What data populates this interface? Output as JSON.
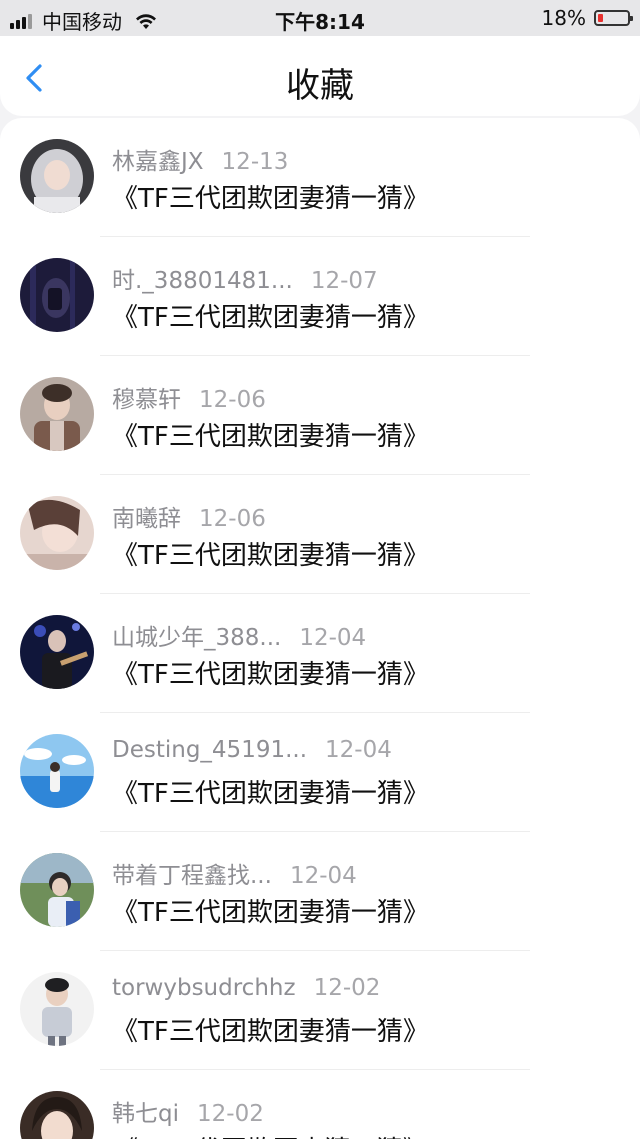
{
  "status_bar": {
    "carrier": "中国移动",
    "time": "下午8:14",
    "battery_percent": "18%",
    "battery_level": 0.18,
    "battery_color": "#e8312f",
    "icons": [
      "signal-icon",
      "wifi-icon",
      "battery-icon"
    ]
  },
  "nav": {
    "title": "收藏",
    "back_icon": "chevron-left-icon",
    "accent": "#2f8ef3"
  },
  "favorites": [
    {
      "user": "林嘉鑫JX",
      "date": "12-13",
      "title": "《TF三代团欺团妻猜一猜》"
    },
    {
      "user": "时._38801481...",
      "date": "12-07",
      "title": "《TF三代团欺团妻猜一猜》"
    },
    {
      "user": "穆慕轩",
      "date": "12-06",
      "title": "《TF三代团欺团妻猜一猜》"
    },
    {
      "user": "南曦辞",
      "date": "12-06",
      "title": "《TF三代团欺团妻猜一猜》"
    },
    {
      "user": "山城少年_388...",
      "date": "12-04",
      "title": "《TF三代团欺团妻猜一猜》"
    },
    {
      "user": "Desting_45191...",
      "date": "12-04",
      "title": "《TF三代团欺团妻猜一猜》"
    },
    {
      "user": "带着丁程鑫找...",
      "date": "12-04",
      "title": "《TF三代团欺团妻猜一猜》"
    },
    {
      "user": "torwybsudrchhz",
      "date": "12-02",
      "title": "《TF三代团欺团妻猜一猜》"
    },
    {
      "user": "韩七qi",
      "date": "12-02",
      "title": "《TF三代团欺团妻猜一猜》"
    }
  ]
}
